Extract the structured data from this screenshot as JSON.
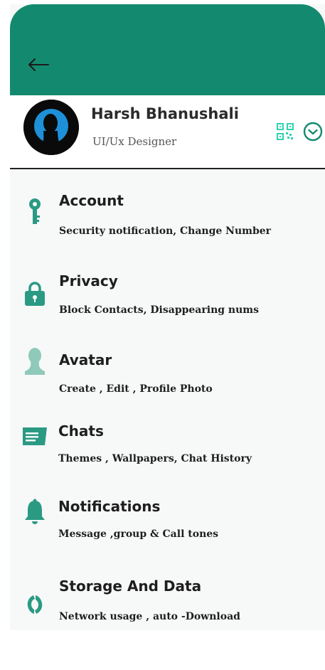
{
  "profile": {
    "name": "Harsh Bhanushali",
    "role": "UI/Ux Designer"
  },
  "colors": {
    "accent": "#138a6f",
    "icon": "#2a9a83",
    "qr": "#2ed3b0"
  },
  "settings": [
    {
      "title": "Account",
      "subtitle": "Security notification, Change Number",
      "icon": "key-icon"
    },
    {
      "title": "Privacy",
      "subtitle": "Block Contacts, Disappearing nums",
      "icon": "lock-icon"
    },
    {
      "title": "Avatar",
      "subtitle": "Create , Edit , Profile Photo",
      "icon": "person-icon"
    },
    {
      "title": "Chats",
      "subtitle": "Themes , Wallpapers, Chat History",
      "icon": "chat-icon"
    },
    {
      "title": "Notifications",
      "subtitle": "Message ,group & Call tones",
      "icon": "bell-icon"
    },
    {
      "title": "Storage And Data",
      "subtitle": "Network usage , auto -Download",
      "icon": "storage-icon"
    }
  ]
}
